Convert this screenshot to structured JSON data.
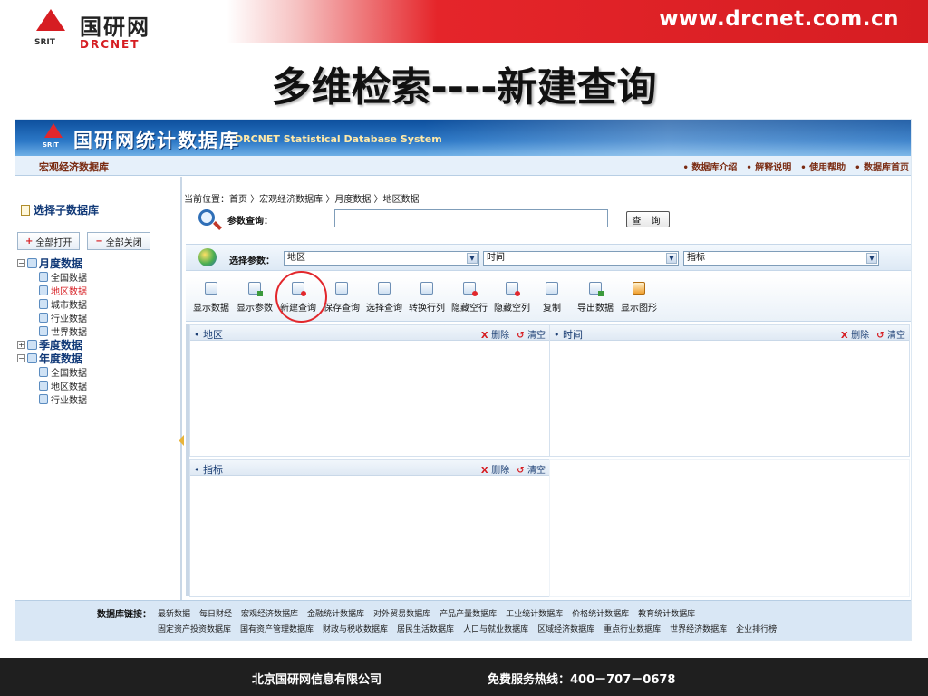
{
  "slide": {
    "url": "www.drcnet.com.cn",
    "logo_cn": "国研网",
    "logo_srit": "SRIT",
    "logo_en": "DRCNET",
    "title": "多维检索----新建查询",
    "footer_company": "北京国研网信息有限公司",
    "footer_hotline": "免费服务热线：400－707－0678"
  },
  "app": {
    "banner_cn": "国研网统计数据库",
    "banner_srit": "SRIT",
    "banner_en": "DRCNET Statistical Database System",
    "name": "宏观经济数据库",
    "top_links": [
      "数据库介绍",
      "解释说明",
      "使用帮助",
      "数据库首页"
    ]
  },
  "sidebar": {
    "title": "选择子数据库",
    "open_all": "全部打开",
    "close_all": "全部关闭",
    "groups": [
      {
        "label": "月度数据",
        "toggle": "−",
        "items": [
          "全国数据",
          "地区数据",
          "城市数据",
          "行业数据",
          "世界数据"
        ]
      },
      {
        "label": "季度数据",
        "toggle": "+",
        "items": []
      },
      {
        "label": "年度数据",
        "toggle": "−",
        "items": [
          "全国数据",
          "地区数据",
          "行业数据"
        ]
      }
    ]
  },
  "main": {
    "breadcrumb": "当前位置：首页 〉宏观经济数据库 〉月度数据 〉地区数据",
    "param_query_label": "参数查询：",
    "param_query_value": "",
    "query_button": "查 询",
    "select_params_label": "选择参数：",
    "selects": [
      "地区",
      "时间",
      "指标"
    ],
    "toolbar": [
      "显示数据",
      "显示参数",
      "新建查询",
      "保存查询",
      "选择查询",
      "转换行列",
      "隐藏空行",
      "隐藏空列",
      "复制",
      "导出数据",
      "显示图形"
    ],
    "panels": [
      {
        "title": "地区",
        "delete": "删除",
        "clear": "清空"
      },
      {
        "title": "时间",
        "delete": "删除",
        "clear": "清空"
      },
      {
        "title": "指标",
        "delete": "删除",
        "clear": "清空"
      }
    ]
  },
  "footer": {
    "label": "数据库链接：",
    "row1": [
      "最新数据",
      "每日财经",
      "宏观经济数据库",
      "金融统计数据库",
      "对外贸易数据库",
      "产品产量数据库",
      "工业统计数据库",
      "价格统计数据库",
      "教育统计数据库"
    ],
    "row2": [
      "固定资产投资数据库",
      "国有资产管理数据库",
      "财政与税收数据库",
      "居民生活数据库",
      "人口与就业数据库",
      "区域经济数据库",
      "重点行业数据库",
      "世界经济数据库",
      "企业排行榜"
    ]
  }
}
